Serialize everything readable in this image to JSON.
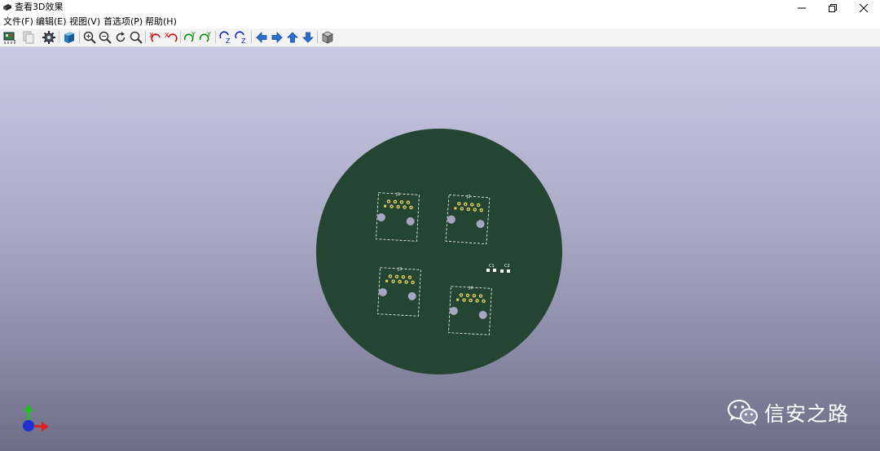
{
  "window": {
    "title": "查看3D效果",
    "controls": [
      "minimize-icon",
      "restore-icon",
      "close-icon"
    ]
  },
  "menu": {
    "file": "文件(F)",
    "edit": "编辑(E)",
    "view": "视图(V)",
    "preferences": "首选项(P)",
    "help": "帮助(H)"
  },
  "toolbar": {
    "buttons": [
      "reload-board-icon",
      "copy-image-icon",
      "settings-gear-icon",
      "box-3d-icon",
      "zoom-in-icon",
      "zoom-out-icon",
      "redraw-icon",
      "zoom-fit-icon",
      "rotate-x-cw-icon",
      "rotate-x-ccw-icon",
      "rotate-y-cw-icon",
      "rotate-y-ccw-icon",
      "rotate-z-cw-icon",
      "rotate-z-ccw-icon",
      "move-left-icon",
      "move-right-icon",
      "move-up-icon",
      "move-down-icon",
      "ortho-view-icon"
    ]
  },
  "board": {
    "color": "#244532",
    "components": {
      "j1": "J1",
      "j2": "J2",
      "j3": "J3",
      "j4": "J4",
      "c1": "C1",
      "c2": "C2"
    },
    "pad_color": "#e8d060",
    "hole_color": "#a8a4c4"
  },
  "axes": {
    "x_color": "#e02020",
    "y_color": "#20c020",
    "z_color": "#2030d0"
  },
  "watermark": {
    "text": "信安之路",
    "icon": "wechat-icon"
  }
}
